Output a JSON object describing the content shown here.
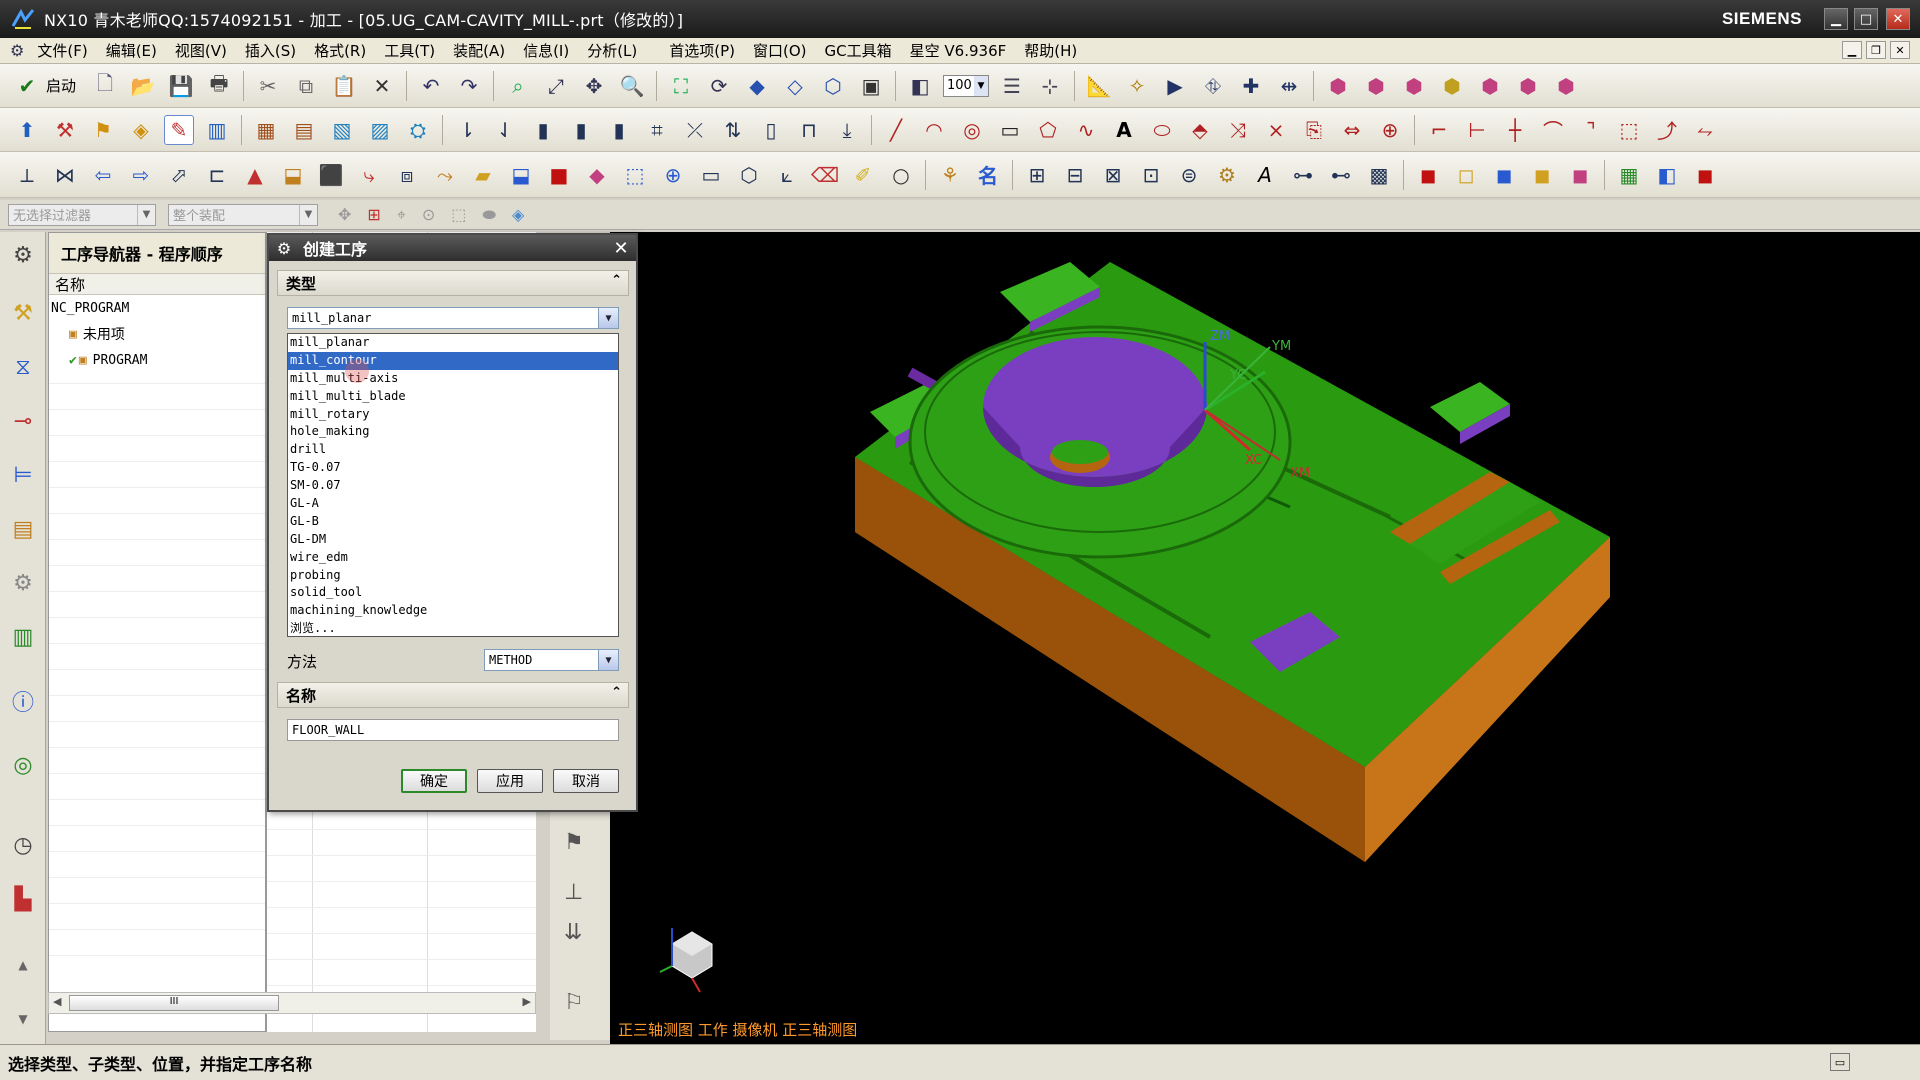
{
  "window": {
    "title": "NX10 青木老师QQ:1574092151 - 加工 - [05.UG_CAM-CAVITY_MILL-.prt（修改的）]",
    "brand": "SIEMENS",
    "controls": [
      "minimize-icon",
      "maximize-icon",
      "close-icon"
    ]
  },
  "menu": {
    "items": [
      "文件(F)",
      "编辑(E)",
      "视图(V)",
      "插入(S)",
      "格式(R)",
      "工具(T)",
      "装配(A)",
      "信息(I)",
      "分析(L)",
      "首选项(P)",
      "窗口(O)",
      "GC工具箱",
      "星空 V6.936F",
      "帮助(H)"
    ]
  },
  "toolbar": {
    "start_label": "启动",
    "zoom_value": "100"
  },
  "selection_bar": {
    "filter_placeholder": "无选择过滤器",
    "assembly_placeholder": "整个装配"
  },
  "navigator": {
    "title": "工序导航器 - 程序顺序",
    "column_name": "名称",
    "root": "NC_PROGRAM",
    "items": [
      {
        "label": "未用项"
      },
      {
        "label": "PROGRAM"
      }
    ],
    "scroll_thumb": "III"
  },
  "dialog": {
    "title": "创建工序",
    "type_group": "类型",
    "type_value": "mill_planar",
    "type_options": [
      "mill_planar",
      "mill_contour",
      "mill_multi-axis",
      "mill_multi_blade",
      "mill_rotary",
      "hole_making",
      "drill",
      "TG-0.07",
      "SM-0.07",
      "GL-A",
      "GL-B",
      "GL-DM",
      "wire_edm",
      "probing",
      "solid_tool",
      "machining_knowledge",
      "浏览..."
    ],
    "selected_option": "mill_contour",
    "method_label": "方法",
    "method_value": "METHOD",
    "name_group": "名称",
    "name_value": "FLOOR_WALL",
    "ok": "确定",
    "apply": "应用",
    "cancel": "取消"
  },
  "graphics": {
    "view_label": "正三轴测图 工作 摄像机 正三轴测图",
    "axis_labels": {
      "zm": "ZM",
      "ym": "YM",
      "yc": "YC",
      "xc": "XC",
      "xm": "XM"
    },
    "colors": {
      "floor": "#2a9a10",
      "wall": "#b5650f",
      "cavity": "#7a3fc0",
      "background": "#000000"
    }
  },
  "status": {
    "text": "选择类型、子类型、位置，并指定工序名称"
  }
}
